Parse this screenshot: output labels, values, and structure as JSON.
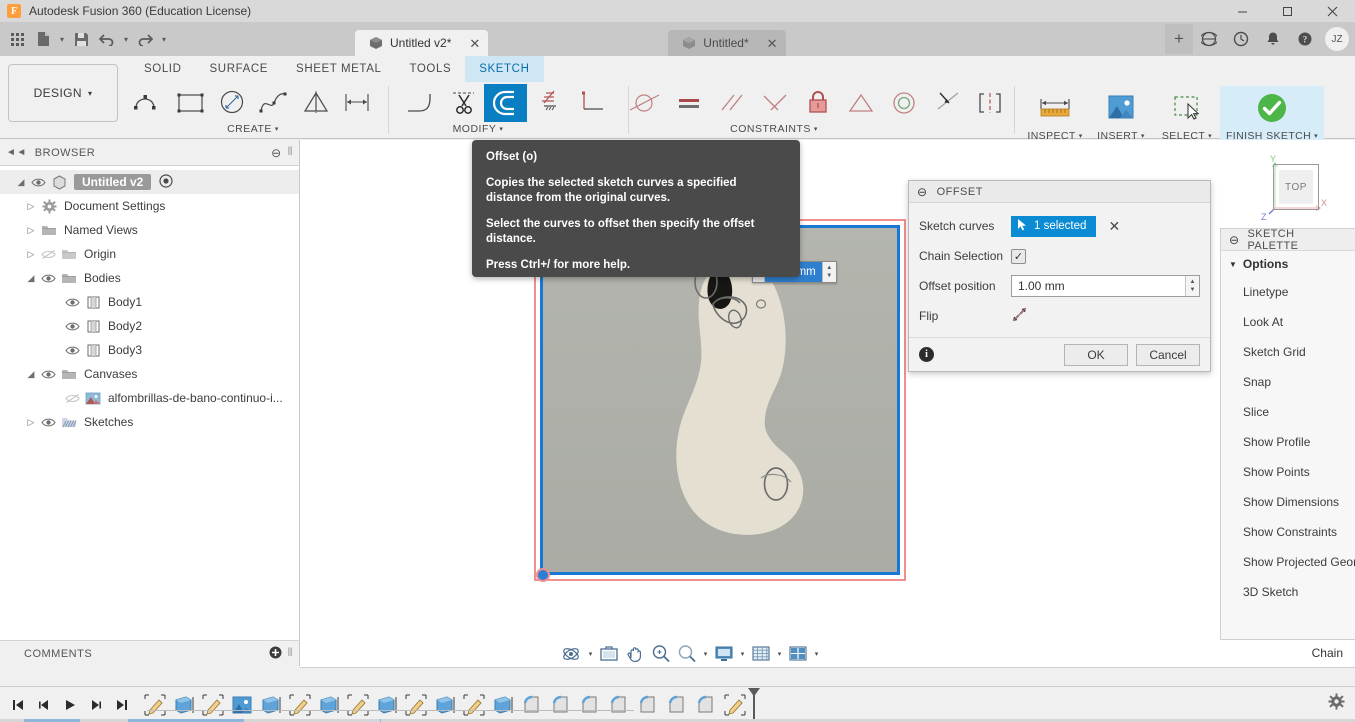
{
  "window": {
    "app_title": "Autodesk Fusion 360 (Education License)",
    "logo_text": "F",
    "minimize": "—",
    "maximize": "□",
    "close": "✕"
  },
  "quick_access": {
    "grid_icon": "app-grid-icon",
    "new_icon": "new-document-icon",
    "save_icon": "save-icon",
    "undo_icon": "undo-icon",
    "redo_icon": "redo-icon"
  },
  "tabs": [
    {
      "label": "Untitled v2*",
      "active": true,
      "close": "✕"
    },
    {
      "label": "Untitled*",
      "active": false,
      "close": "✕"
    }
  ],
  "tab_right": {
    "plus": "+",
    "icons": [
      "globe-icon",
      "clock-icon",
      "bell-icon",
      "help-icon"
    ],
    "avatar_initials": "JZ"
  },
  "ribbon": {
    "design_label": "DESIGN",
    "design_caret": "▾",
    "workspace_tabs": [
      {
        "label": "SOLID",
        "active": false
      },
      {
        "label": "SURFACE",
        "active": false
      },
      {
        "label": "SHEET METAL",
        "active": false
      },
      {
        "label": "TOOLS",
        "active": false
      },
      {
        "label": "SKETCH",
        "active": true
      }
    ],
    "groups": [
      {
        "label": "CREATE",
        "caret": "▾"
      },
      {
        "label": "MODIFY",
        "caret": "▾"
      },
      {
        "label": "CONSTRAINTS",
        "caret": "▾"
      }
    ],
    "create_tools": [
      "arc-icon",
      "rectangle-icon",
      "ellipse-icon",
      "spline-icon",
      "mirror-icon",
      "dimension-icon"
    ],
    "modify_tools": [
      "fillet-icon",
      "trim-scissors-icon",
      "offset-icon",
      "break-icon",
      "perpendicular-line-icon"
    ],
    "constraint_tools": [
      "tangent-icon",
      "equal-icon",
      "parallel-icon",
      "perpendicular-icon",
      "fix-lock-icon",
      "midpoint-icon",
      "concentric-icon",
      "coincident-icon",
      "symmetry-icon"
    ],
    "right_buttons": [
      {
        "label": "INSPECT",
        "caret": "▾",
        "icon": "measure-icon"
      },
      {
        "label": "INSERT",
        "caret": "▾",
        "icon": "insert-image-icon"
      },
      {
        "label": "SELECT",
        "caret": "▾",
        "icon": "select-cursor-icon"
      },
      {
        "label": "FINISH SKETCH",
        "caret": "▾",
        "icon": "green-check-icon"
      }
    ]
  },
  "browser": {
    "title": "BROWSER",
    "collapse_icon": "collapse-left-icon",
    "options_icon": "panel-options-icon",
    "grip_icon": "panel-grip-icon",
    "tree": [
      {
        "label": "Untitled v2",
        "indent": 0,
        "arrow": "◢",
        "eye": true,
        "icon": "component-icon",
        "root": true
      },
      {
        "label": "Document Settings",
        "indent": 1,
        "arrow": "▷",
        "eye": false,
        "icon": "gear-icon"
      },
      {
        "label": "Named Views",
        "indent": 1,
        "arrow": "▷",
        "eye": false,
        "icon": "folder-icon"
      },
      {
        "label": "Origin",
        "indent": 1,
        "arrow": "▷",
        "eye": true,
        "eye_off": true,
        "icon": "folder-icon"
      },
      {
        "label": "Bodies",
        "indent": 1,
        "arrow": "◢",
        "eye": true,
        "icon": "folder-icon"
      },
      {
        "label": "Body1",
        "indent": 2,
        "arrow": "",
        "eye": true,
        "icon": "body-icon"
      },
      {
        "label": "Body2",
        "indent": 2,
        "arrow": "",
        "eye": true,
        "icon": "body-icon"
      },
      {
        "label": "Body3",
        "indent": 2,
        "arrow": "",
        "eye": true,
        "icon": "body-icon"
      },
      {
        "label": "Canvases",
        "indent": 1,
        "arrow": "◢",
        "eye": true,
        "icon": "folder-icon"
      },
      {
        "label": "alfombrillas-de-bano-continuo-i...",
        "indent": 2,
        "arrow": "",
        "eye": true,
        "eye_off": true,
        "icon": "canvas-image-icon"
      },
      {
        "label": "Sketches",
        "indent": 1,
        "arrow": "▷",
        "eye": true,
        "icon": "sketches-folder-icon"
      }
    ]
  },
  "comments": {
    "title": "COMMENTS",
    "add_icon": "add-comment-icon",
    "grip_icon": "panel-grip-icon"
  },
  "tooltip": {
    "title": "Offset (o)",
    "paragraph1": "Copies the selected sketch curves a specified distance from the original curves.",
    "paragraph2": "Select the curves to offset then specify the offset distance.",
    "paragraph3": "Press Ctrl+/ for more help."
  },
  "offset_dialog": {
    "title": "OFFSET",
    "collapse_icon": "minus-circle-icon",
    "fields": {
      "sketch_curves_label": "Sketch curves",
      "sketch_curves_value": "1 selected",
      "sketch_curves_cursor_icon": "select-cursor-icon",
      "clear_icon": "✕",
      "chain_selection_label": "Chain Selection",
      "chain_selection_checked": "✓",
      "offset_position_label": "Offset position",
      "offset_position_value": "1.00 mm",
      "flip_label": "Flip",
      "flip_icon": "flip-arrows-icon"
    },
    "info_icon": "i",
    "ok_label": "OK",
    "cancel_label": "Cancel"
  },
  "canvas": {
    "inline_dimension_value": "1.00 mm",
    "view_cube_face": "TOP",
    "axis_x": "X",
    "axis_y": "Y",
    "axis_z": "Z",
    "selection_color": "#1878d4",
    "offset_preview_color": "#ef8f90",
    "sheet_color": "#aeb0a9"
  },
  "sketch_palette": {
    "title": "SKETCH PALETTE",
    "collapse_icon": "minus-circle-icon",
    "section_label": "Options",
    "section_caret": "▼",
    "items": [
      "Linetype",
      "Look At",
      "Sketch Grid",
      "Snap",
      "Slice",
      "Show Profile",
      "Show Points",
      "Show Dimensions",
      "Show Constraints",
      "Show Projected Geometr",
      "3D Sketch"
    ]
  },
  "nav_bar": {
    "buttons": [
      {
        "icon": "orbit-icon",
        "caret": "▾"
      },
      {
        "icon": "look-at-icon",
        "caret": ""
      },
      {
        "icon": "pan-hand-icon",
        "caret": ""
      },
      {
        "icon": "zoom-icon",
        "caret": ""
      },
      {
        "icon": "zoom-window-icon",
        "caret": "▾"
      },
      {
        "icon": "display-settings-icon",
        "caret": "▾"
      },
      {
        "icon": "grid-snap-icon",
        "caret": "▾"
      },
      {
        "icon": "viewports-icon",
        "caret": "▾"
      }
    ]
  },
  "status": {
    "chain_label": "Chain"
  },
  "timeline": {
    "controls": [
      "skip-start-icon",
      "step-back-icon",
      "play-icon",
      "step-forward-icon",
      "skip-end-icon"
    ],
    "features": [
      {
        "type": "sketch"
      },
      {
        "type": "extrude"
      },
      {
        "type": "sketch"
      },
      {
        "type": "canvas"
      },
      {
        "type": "extrude"
      },
      {
        "type": "sketch"
      },
      {
        "type": "extrude"
      },
      {
        "type": "sketch"
      },
      {
        "type": "extrude"
      },
      {
        "type": "sketch"
      },
      {
        "type": "extrude"
      },
      {
        "type": "sketch"
      },
      {
        "type": "extrude"
      },
      {
        "type": "fillet"
      },
      {
        "type": "fillet"
      },
      {
        "type": "fillet"
      },
      {
        "type": "fillet"
      },
      {
        "type": "fillet"
      },
      {
        "type": "fillet"
      },
      {
        "type": "fillet"
      },
      {
        "type": "sketch"
      }
    ],
    "settings_icon": "gear-icon",
    "marker_icon": "timeline-marker-icon"
  }
}
